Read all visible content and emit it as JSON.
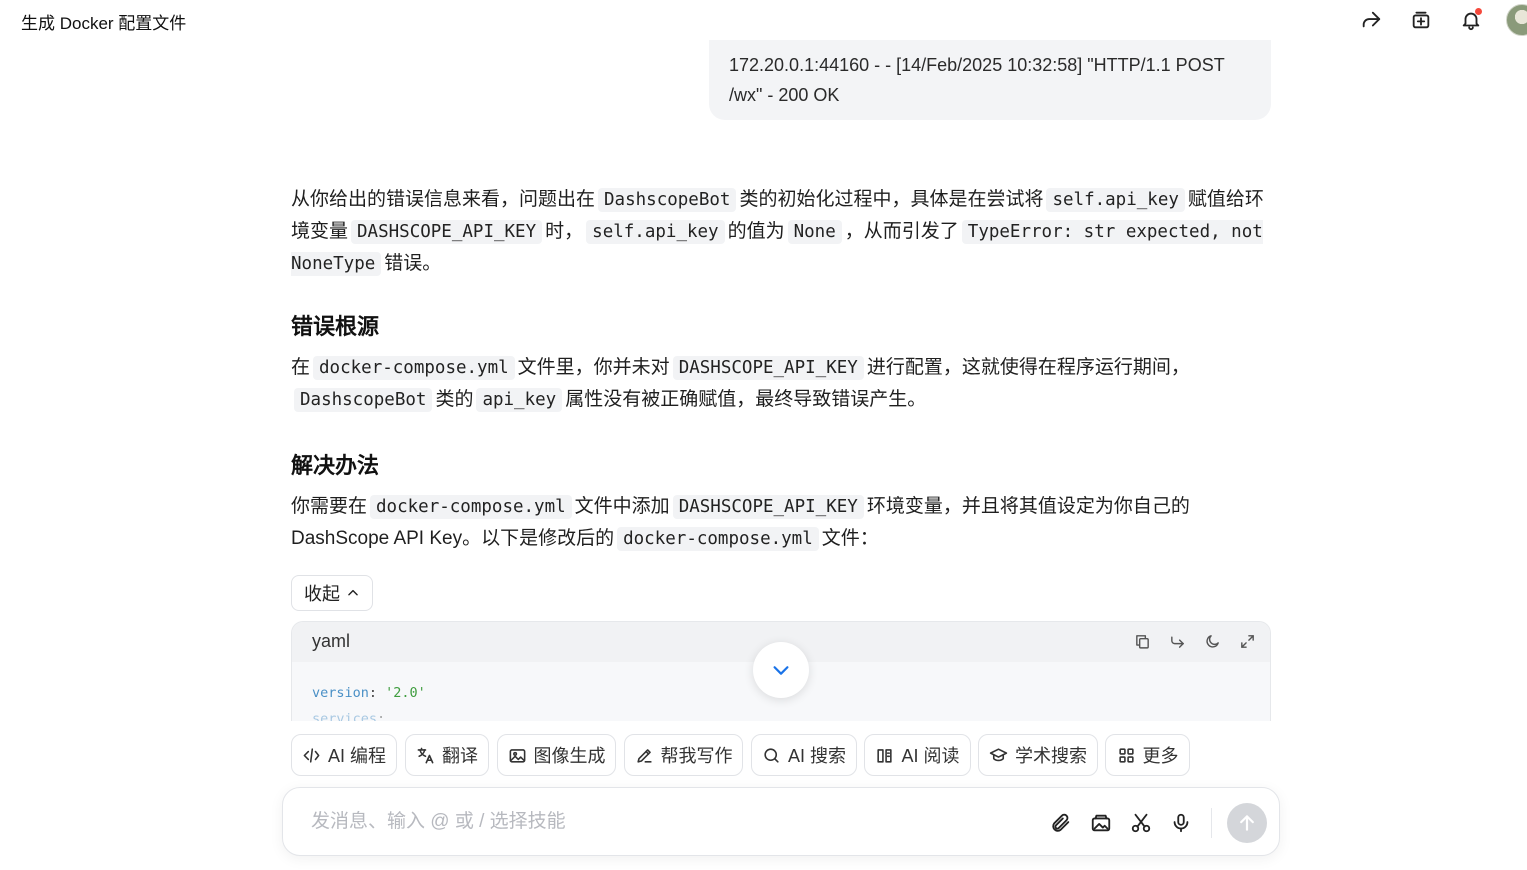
{
  "header": {
    "title": "生成 Docker 配置文件",
    "icons": [
      "share-icon",
      "add-to-collection-icon",
      "bell-icon",
      "avatar"
    ]
  },
  "user_message": {
    "line1": "172.20.0.1:44160 - - [14/Feb/2025 10:32:58] \"HTTP/1.1 POST",
    "line2": "/wx\" - 200 OK"
  },
  "answer": {
    "p1": {
      "t1": "从你给出的错误信息来看，问题出在",
      "c1": "DashscopeBot",
      "t2": "类的初始化过程中，具体是在尝试将",
      "c2": "self.api_key",
      "t3": "赋值给环境变量",
      "c3": "DASHSCOPE_API_KEY",
      "t4": "时，",
      "c4": "self.api_key",
      "t5": "的值为",
      "c5": "None",
      "t6": "，从而引发了",
      "c6": "TypeError: str expected, not NoneType",
      "t7": "错误。"
    },
    "h1": "错误根源",
    "p2": {
      "t1": "在",
      "c1": "docker-compose.yml",
      "t2": "文件里，你并未对",
      "c2": "DASHSCOPE_API_KEY",
      "t3": "进行配置，这就使得在程序运行期间，",
      "c3": "DashscopeBot",
      "t4": "类的",
      "c4": "api_key",
      "t5": "属性没有被正确赋值，最终导致错误产生。"
    },
    "h2": "解决办法",
    "p3": {
      "t1": "你需要在",
      "c1": "docker-compose.yml",
      "t2": "文件中添加",
      "c2": "DASHSCOPE_API_KEY",
      "t3": "环境变量，并且将其值设定为你自己的 DashScope API Key。以下是修改后的",
      "c3": "docker-compose.yml",
      "t4": "文件："
    }
  },
  "collapse_label": "收起",
  "code_block": {
    "language": "yaml",
    "lines": [
      {
        "key": "version",
        "sep": ": ",
        "value": "'2.0'"
      },
      {
        "key": "services",
        "sep": ":",
        "value": ""
      }
    ]
  },
  "skills": [
    {
      "label": "AI 编程",
      "icon": "code-icon"
    },
    {
      "label": "翻译",
      "icon": "translate-icon"
    },
    {
      "label": "图像生成",
      "icon": "image-icon"
    },
    {
      "label": "帮我写作",
      "icon": "pen-icon"
    },
    {
      "label": "AI 搜索",
      "icon": "search-icon"
    },
    {
      "label": "AI 阅读",
      "icon": "reader-icon"
    },
    {
      "label": "学术搜索",
      "icon": "academic-icon"
    },
    {
      "label": "更多",
      "icon": "grid-icon"
    }
  ],
  "composer": {
    "placeholder": "发消息、输入 @ 或 / 选择技能"
  }
}
